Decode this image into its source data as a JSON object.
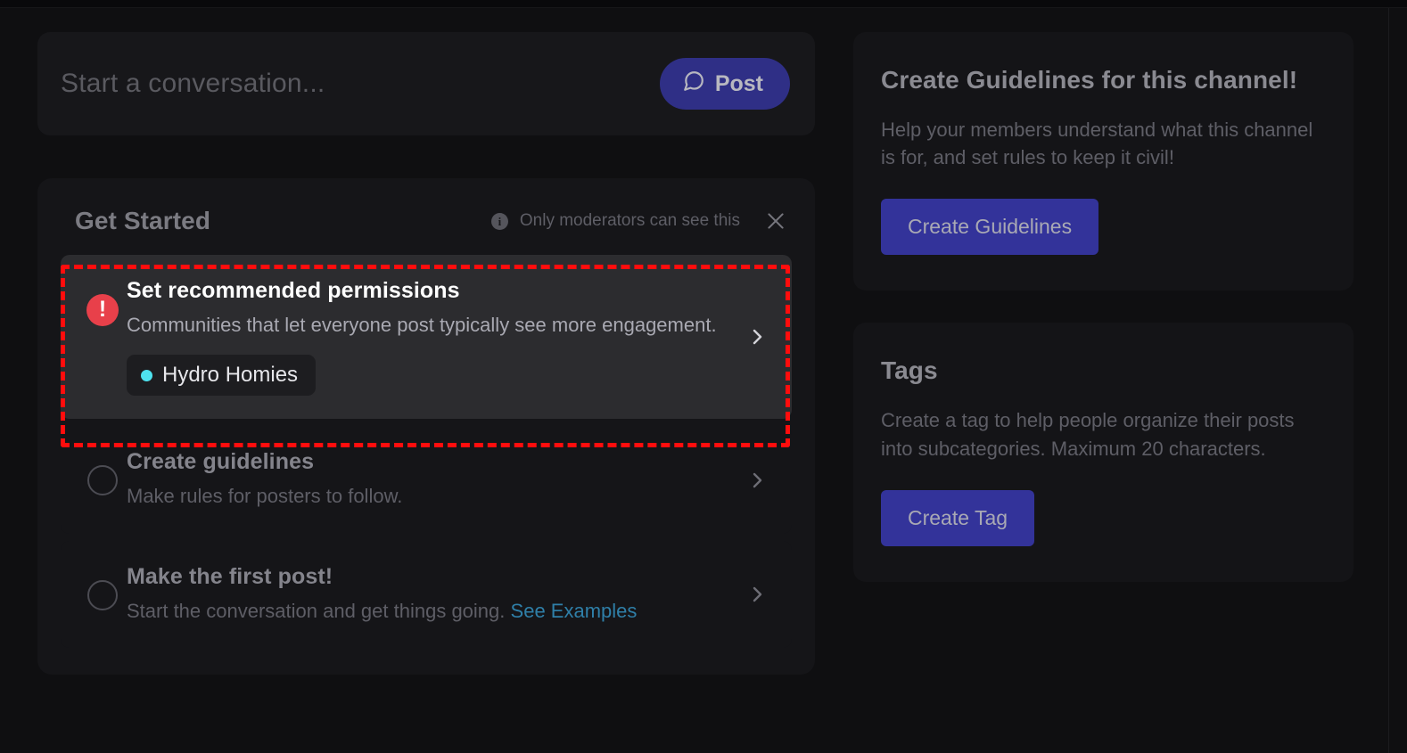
{
  "composer": {
    "placeholder": "Start a conversation...",
    "post_label": "Post",
    "post_icon": "speech-bubble-icon",
    "accent_color": "#2f2f86"
  },
  "get_started": {
    "title": "Get Started",
    "moderator_note": "Only moderators can see this",
    "info_icon": "info-icon",
    "close_icon": "close-icon",
    "tasks": [
      {
        "status_icon": "alert-exclamation-icon",
        "status_color": "#e8404a",
        "title": "Set recommended permissions",
        "description": "Communities that let everyone post typically see more engagement.",
        "tag": {
          "label": "Hydro Homies",
          "dot_color": "#4ee2ef"
        },
        "chevron_icon": "chevron-right-icon",
        "highlighted": true
      },
      {
        "status_icon": "circle-empty-icon",
        "title": "Create guidelines",
        "description": "Make rules for posters to follow.",
        "chevron_icon": "chevron-right-icon",
        "highlighted": false
      },
      {
        "status_icon": "circle-empty-icon",
        "title": "Make the first post!",
        "description": "Start the conversation and get things going.",
        "link_text": "See Examples",
        "link_color": "#2f7fa8",
        "chevron_icon": "chevron-right-icon",
        "highlighted": false
      }
    ]
  },
  "sidebar": {
    "panels": [
      {
        "title": "Create Guidelines for this channel!",
        "description": "Help your members understand what this channel is for, and set rules to keep it civil!",
        "button_label": "Create Guidelines",
        "button_color": "#33339a"
      },
      {
        "title": "Tags",
        "description": "Create a tag to help people organize their posts into subcategories. Maximum 20 characters.",
        "button_label": "Create Tag",
        "button_color": "#33339a"
      }
    ]
  },
  "annotation": {
    "type": "dashed-highlight-box",
    "color": "#ff0d0d",
    "targets": "set-recommended-permissions-task"
  }
}
